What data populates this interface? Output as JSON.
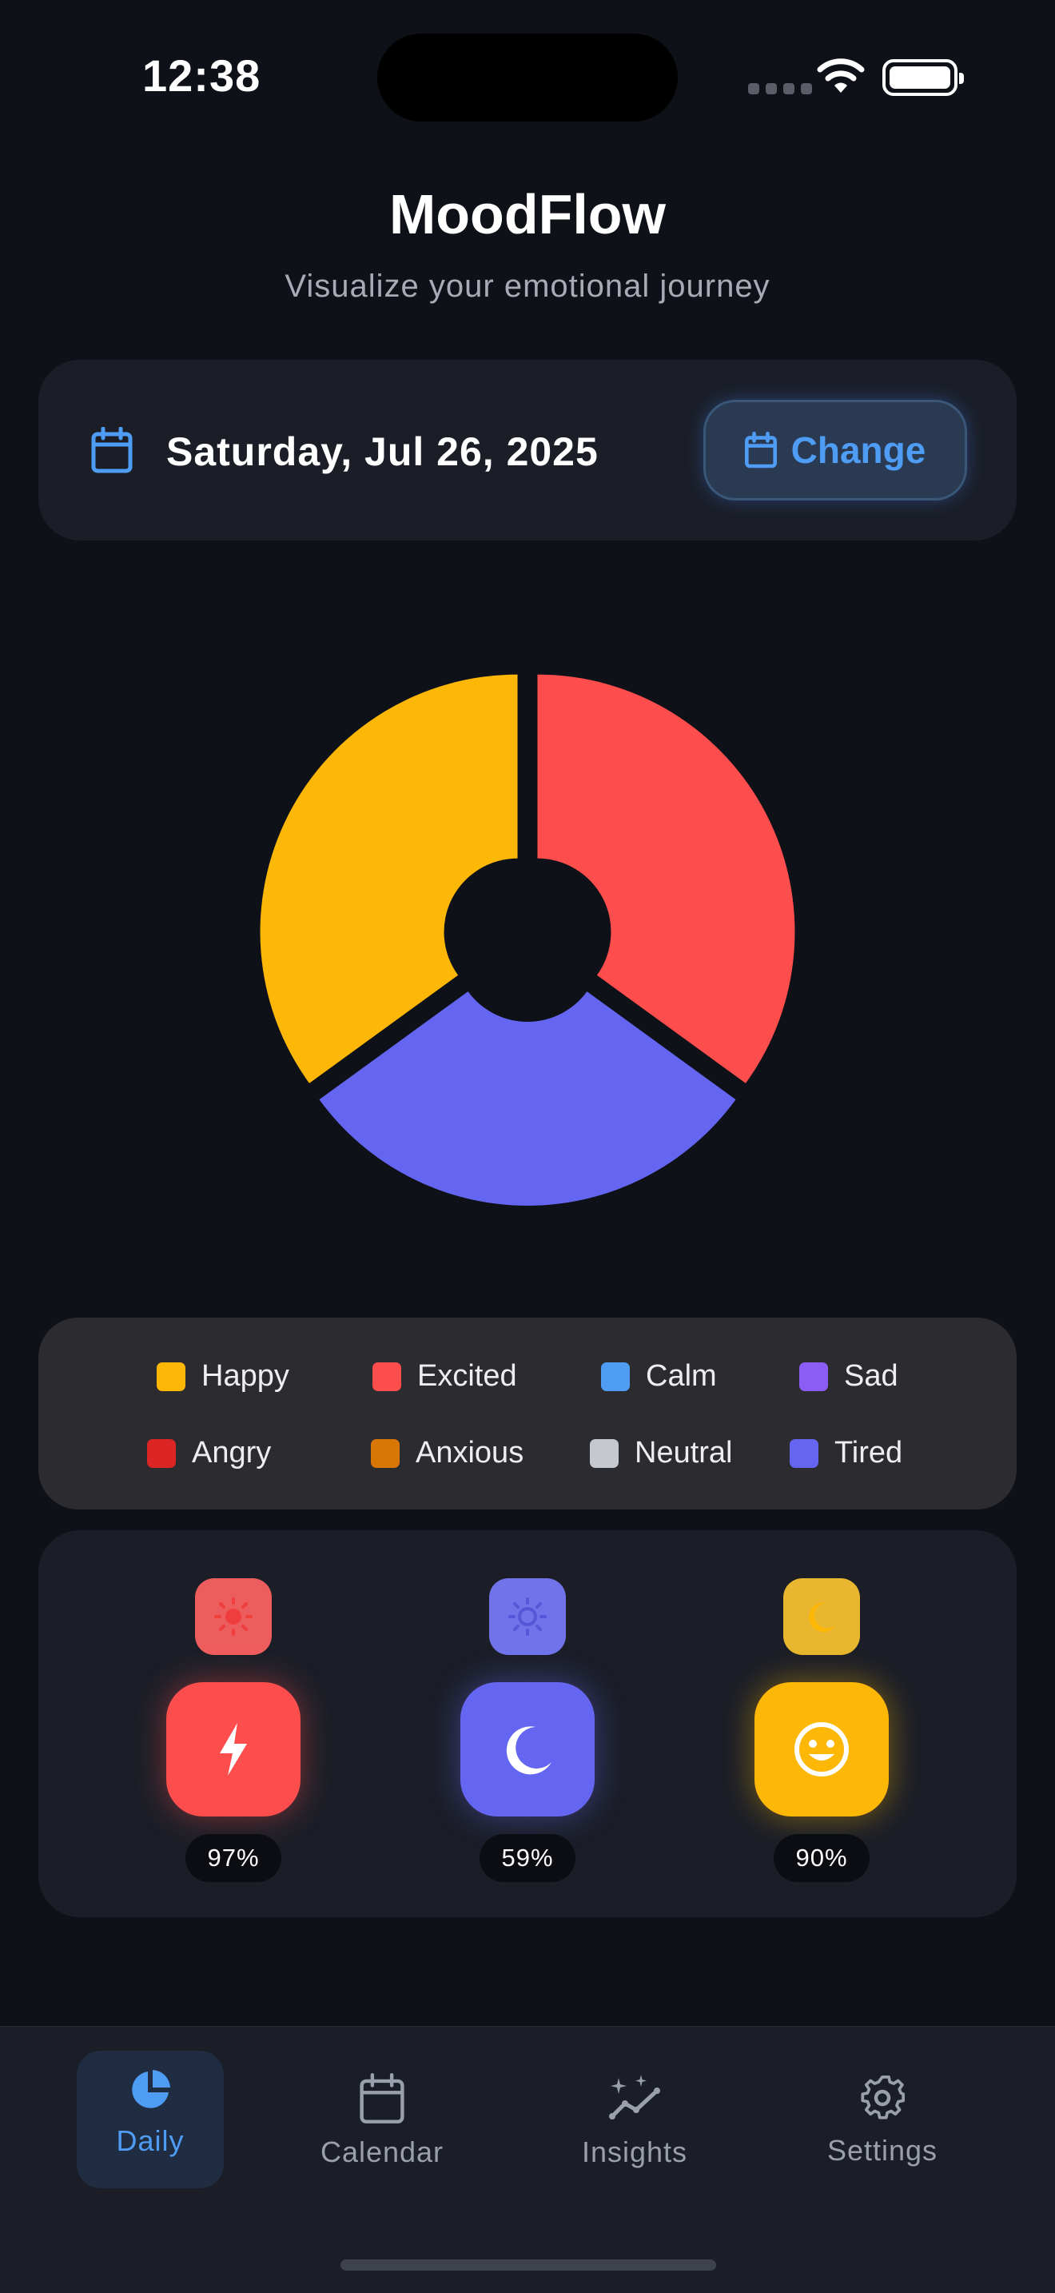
{
  "status_bar": {
    "time": "12:38"
  },
  "header": {
    "title": "MoodFlow",
    "subtitle": "Visualize your emotional journey"
  },
  "date_card": {
    "date": "Saturday, Jul 26, 2025",
    "change_label": "Change",
    "icon": "calendar-icon"
  },
  "chart_data": {
    "type": "pie",
    "style": "donut",
    "slices": [
      {
        "label": "Excited",
        "value": 35,
        "color": "#fd4d4d"
      },
      {
        "label": "Tired",
        "value": 30,
        "color": "#6466f1"
      },
      {
        "label": "Happy",
        "value": 35,
        "color": "#fdb707"
      }
    ]
  },
  "legend": [
    {
      "label": "Happy",
      "color": "#fdb707"
    },
    {
      "label": "Excited",
      "color": "#fd4d4d"
    },
    {
      "label": "Calm",
      "color": "#4f9cf5"
    },
    {
      "label": "Sad",
      "color": "#8c5cf5"
    },
    {
      "label": "Angry",
      "color": "#dc2626"
    },
    {
      "label": "Anxious",
      "color": "#d97706"
    },
    {
      "label": "Neutral",
      "color": "#c6c8d0"
    },
    {
      "label": "Tired",
      "color": "#6466f1"
    }
  ],
  "mood_stats": [
    {
      "mini_icon": "sun-icon",
      "icon": "lightning-icon",
      "percent": "97%",
      "color": "#fd4d4d",
      "mini_color": "#ee5d5d"
    },
    {
      "mini_icon": "sun-icon",
      "icon": "moon-icon",
      "percent": "59%",
      "color": "#6466f1",
      "mini_color": "#7073e9"
    },
    {
      "mini_icon": "moon-icon",
      "icon": "smile-icon",
      "percent": "90%",
      "color": "#fdb707",
      "mini_color": "#e8b62f"
    }
  ],
  "tabs": [
    {
      "label": "Daily",
      "icon": "pie-chart-icon",
      "active": true
    },
    {
      "label": "Calendar",
      "icon": "calendar-icon",
      "active": false
    },
    {
      "label": "Insights",
      "icon": "sparkle-chart-icon",
      "active": false
    },
    {
      "label": "Settings",
      "icon": "gear-icon",
      "active": false
    }
  ],
  "colors": {
    "accent": "#4f9cf5",
    "background": "#0e1118",
    "card": "#1b1e27"
  }
}
